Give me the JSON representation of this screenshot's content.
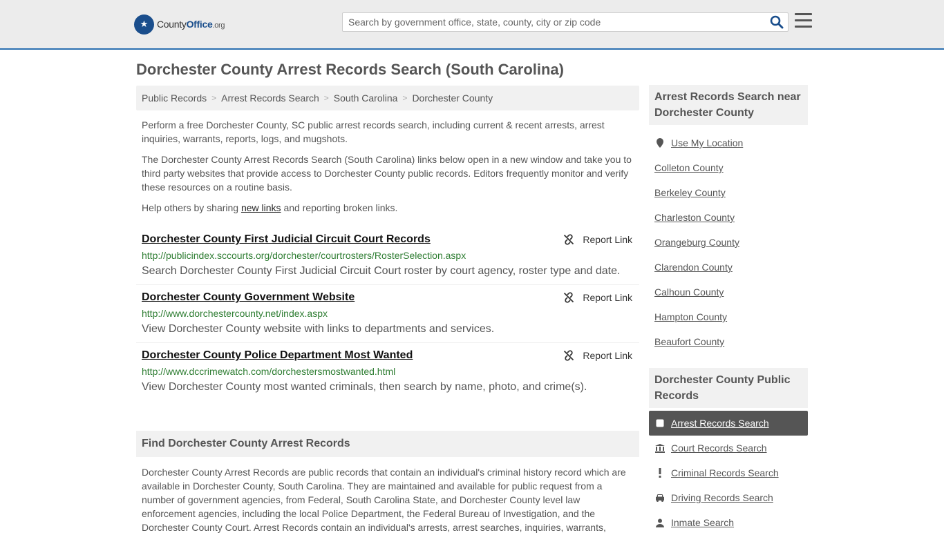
{
  "header": {
    "logo_prefix": "County",
    "logo_highlight": "Office",
    "logo_suffix": ".org",
    "search_placeholder": "Search by government office, state, county, city or zip code"
  },
  "page": {
    "title": "Dorchester County Arrest Records Search (South Carolina)"
  },
  "breadcrumb": [
    "Public Records",
    "Arrest Records Search",
    "South Carolina",
    "Dorchester County"
  ],
  "intro": {
    "p1": "Perform a free Dorchester County, SC public arrest records search, including current & recent arrests, arrest inquiries, warrants, reports, logs, and mugshots.",
    "p2": "The Dorchester County Arrest Records Search (South Carolina) links below open in a new window and take you to third party websites that provide access to Dorchester County public records. Editors frequently monitor and verify these resources on a routine basis.",
    "p3_before": "Help others by sharing ",
    "p3_link": "new links",
    "p3_after": " and reporting broken links."
  },
  "report_label": "Report Link",
  "links": [
    {
      "title": "Dorchester County First Judicial Circuit Court Records",
      "url": "http://publicindex.sccourts.org/dorchester/courtrosters/RosterSelection.aspx",
      "desc": "Search Dorchester County First Judicial Circuit Court roster by court agency, roster type and date."
    },
    {
      "title": "Dorchester County Government Website",
      "url": "http://www.dorchestercounty.net/index.aspx",
      "desc": "View Dorchester County website with links to departments and services."
    },
    {
      "title": "Dorchester County Police Department Most Wanted",
      "url": "http://www.dccrimewatch.com/dorchestersmostwanted.html",
      "desc": "View Dorchester County most wanted criminals, then search by name, photo, and crime(s)."
    }
  ],
  "find_section": {
    "title": "Find Dorchester County Arrest Records",
    "body": "Dorchester County Arrest Records are public records that contain an individual's criminal history record which are available in Dorchester County, South Carolina. They are maintained and available for public request from a number of government agencies, from Federal, South Carolina State, and Dorchester County level law enforcement agencies, including the local Police Department, the Federal Bureau of Investigation, and the Dorchester County Court. Arrest Records contain an individual's arrests, arrest searches, inquiries, warrants,"
  },
  "sidebar": {
    "nearby_title": "Arrest Records Search near Dorchester County",
    "use_location": "Use My Location",
    "counties": [
      "Colleton County",
      "Berkeley County",
      "Charleston County",
      "Orangeburg County",
      "Clarendon County",
      "Calhoun County",
      "Hampton County",
      "Beaufort County"
    ],
    "public_title": "Dorchester County Public Records",
    "public_items": [
      {
        "label": "Arrest Records Search",
        "icon": "square-icon",
        "active": true
      },
      {
        "label": "Court Records Search",
        "icon": "courthouse-icon",
        "active": false
      },
      {
        "label": "Criminal Records Search",
        "icon": "exclamation-icon",
        "active": false
      },
      {
        "label": "Driving Records Search",
        "icon": "car-icon",
        "active": false
      },
      {
        "label": "Inmate Search",
        "icon": "user-icon",
        "active": false
      }
    ]
  }
}
